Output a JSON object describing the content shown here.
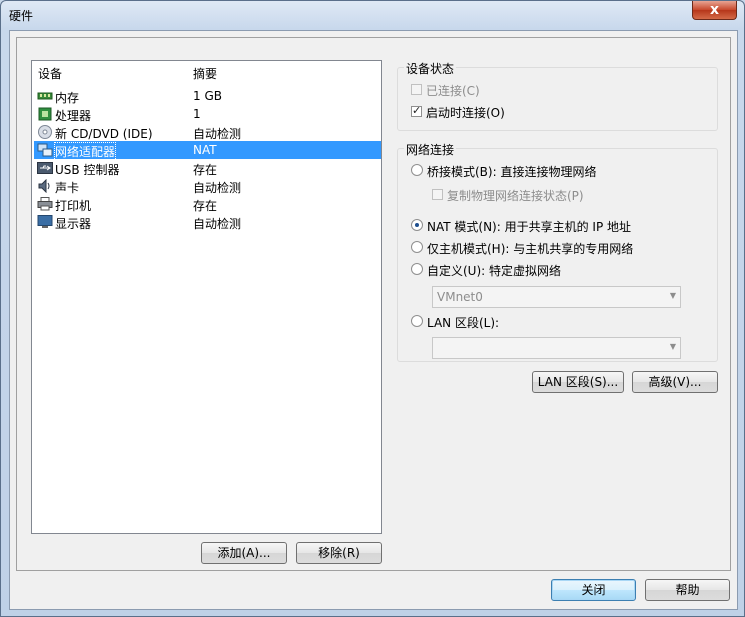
{
  "window": {
    "title": "硬件",
    "close_glyph": "x"
  },
  "device_list": {
    "columns": [
      "设备",
      "摘要"
    ],
    "items": [
      {
        "name": "内存",
        "summary": "1 GB",
        "icon": "memory-icon"
      },
      {
        "name": "处理器",
        "summary": "1",
        "icon": "cpu-icon"
      },
      {
        "name": "新 CD/DVD (IDE)",
        "summary": "自动检测",
        "icon": "cd-icon"
      },
      {
        "name": "网络适配器",
        "summary": "NAT",
        "icon": "network-icon",
        "selected": true
      },
      {
        "name": "USB 控制器",
        "summary": "存在",
        "icon": "usb-icon"
      },
      {
        "name": "声卡",
        "summary": "自动检测",
        "icon": "sound-icon"
      },
      {
        "name": "打印机",
        "summary": "存在",
        "icon": "printer-icon"
      },
      {
        "name": "显示器",
        "summary": "自动检测",
        "icon": "display-icon"
      }
    ]
  },
  "list_buttons": {
    "add": "添加(A)...",
    "remove": "移除(R)"
  },
  "device_status": {
    "title": "设备状态",
    "connected": "已连接(C)",
    "connect_at_power_on": "启动时连接(O)"
  },
  "network_connection": {
    "title": "网络连接",
    "bridged": "桥接模式(B): 直接连接物理网络",
    "replicate": "复制物理网络连接状态(P)",
    "nat": "NAT 模式(N): 用于共享主机的 IP 地址",
    "host_only": "仅主机模式(H): 与主机共享的专用网络",
    "custom": "自定义(U): 特定虚拟网络",
    "custom_value": "VMnet0",
    "lan_segment": "LAN 区段(L):",
    "lan_value": ""
  },
  "side_buttons": {
    "lan_segments": "LAN 区段(S)...",
    "advanced": "高级(V)..."
  },
  "dialog_buttons": {
    "close": "关闭",
    "help": "帮助"
  }
}
